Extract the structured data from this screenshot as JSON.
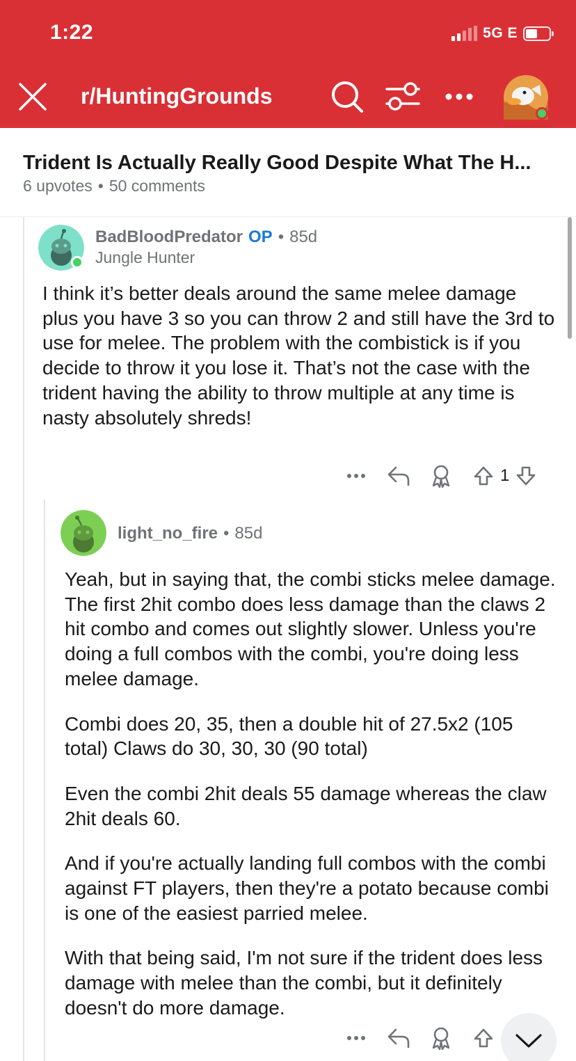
{
  "status_bar": {
    "time": "1:22",
    "network": "5G E"
  },
  "header": {
    "subreddit": "r/HuntingGrounds",
    "close_icon": "close-icon",
    "search_icon": "search-icon",
    "filter_icon": "filter-icon",
    "more_icon": "more-icon",
    "avatar_icon": "user-avatar"
  },
  "post": {
    "title": "Trident Is Actually Really Good Despite What The H...",
    "upvotes": "6 upvotes",
    "separator": "•",
    "comments": "50 comments"
  },
  "comments": [
    {
      "author": "BadBloodPredator",
      "op_label": "OP",
      "separator": "•",
      "age": "85d",
      "flair": "Jungle Hunter",
      "paragraphs": [
        "I think it’s better deals around the same melee damage plus you have 3 so you can throw 2 and still have the 3rd to use for melee. The problem with the combistick is if you decide to throw it you lose it. That’s not the case with the trident having the ability to throw multiple at any time is nasty absolutely shreds!"
      ],
      "actions": {
        "more": "more-icon",
        "reply": "reply-icon",
        "award": "award-icon",
        "upvote": "upvote-icon",
        "score": "1",
        "downvote": "downvote-icon"
      }
    },
    {
      "author": "light_no_fire",
      "separator": "•",
      "age": "85d",
      "paragraphs": [
        "Yeah, but in saying that, the combi sticks melee damage. The first 2hit combo does less damage than the claws 2 hit combo and comes out slightly slower. Unless you're doing a full combos with the combi, you're doing less melee damage.",
        "Combi does 20, 35, then a double hit of 27.5x2 (105 total) Claws do 30, 30, 30 (90 total)",
        "Even the combi 2hit deals 55 damage whereas the claw 2hit deals 60.",
        "And if you're actually landing full combos with the combi against FT players, then they're a potato because combi is one of the easiest parried melee.",
        "With that being said, I'm not sure if the trident does less damage with melee than the combi, but it definitely doesn't do more damage."
      ],
      "actions": {
        "more": "more-icon",
        "reply": "reply-icon",
        "award": "award-icon",
        "upvote": "upvote-icon"
      }
    }
  ],
  "jump_button_icon": "chevron-down-icon",
  "colors": {
    "brand_red": "#d93036",
    "op_blue": "#1a7ad9",
    "meta_gray": "#6f7276",
    "online_green": "#46d160"
  }
}
